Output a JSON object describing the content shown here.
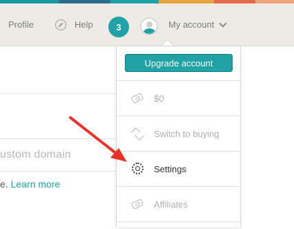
{
  "colors": {
    "accent": "#1fa1a5",
    "strip": [
      "#1a9aa0",
      "#2f6b8e",
      "#e8a33c",
      "#e56b4d",
      "#cf4d6f",
      "#9fbf6b"
    ],
    "arrow": "#e8322b"
  },
  "nav": {
    "profile": "Profile",
    "help": "Help",
    "notifications_count": "3",
    "account": "My account"
  },
  "page": {
    "domain_placeholder": "ustom domain",
    "learn_prefix": "e.",
    "learn_link": "Learn more"
  },
  "dropdown": {
    "upgrade": "Upgrade account",
    "items": [
      {
        "label": "$0",
        "icon": "money-icon"
      },
      {
        "label": "Switch to buying",
        "icon": "swap-icon"
      },
      {
        "label": "Settings",
        "icon": "gear-icon"
      },
      {
        "label": "Affiliates",
        "icon": "affiliates-icon"
      }
    ]
  }
}
